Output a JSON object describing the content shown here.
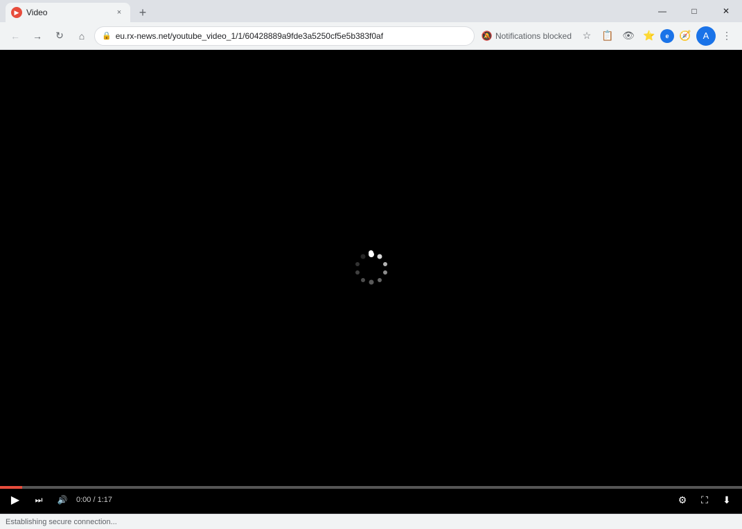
{
  "window": {
    "title": "Video",
    "favicon": "▶",
    "close_btn": "✕",
    "minimize_btn": "—",
    "maximize_btn": "□"
  },
  "tab": {
    "label": "Video",
    "close_icon": "×"
  },
  "new_tab": {
    "icon": "+"
  },
  "toolbar": {
    "back_icon": "←",
    "forward_icon": "→",
    "reload_icon": "↻",
    "home_icon": "⌂",
    "url": "eu.rx-news.net/youtube_video_1/1/60428889a9fde3a5250cf5e5b383f0af",
    "lock_icon": "🔒",
    "notifications_blocked": "Notifications blocked",
    "star_icon": "☆",
    "more_icon": "⋮"
  },
  "video": {
    "loading": true
  },
  "controls": {
    "play_icon": "▶",
    "next_icon": "⏭",
    "volume_icon": "🔊",
    "time": "0:00 / 1:17",
    "settings_icon": "⚙",
    "fullscreen_icon": "⛶",
    "download_icon": "⬇"
  },
  "status": {
    "text": "Establishing secure connection..."
  }
}
